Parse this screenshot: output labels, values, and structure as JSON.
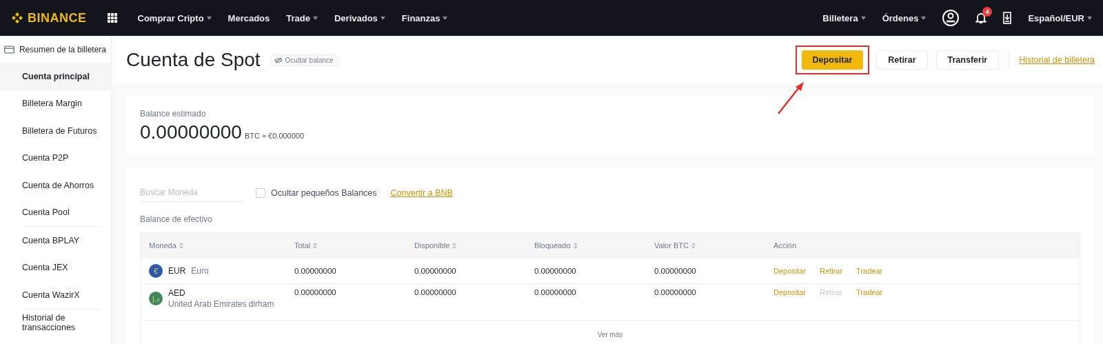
{
  "topbar": {
    "logo": "BINANCE",
    "nav": [
      {
        "label": "Comprar Cripto",
        "dropdown": true
      },
      {
        "label": "Mercados",
        "dropdown": false
      },
      {
        "label": "Trade",
        "dropdown": true
      },
      {
        "label": "Derivados",
        "dropdown": true
      },
      {
        "label": "Finanzas",
        "dropdown": true
      }
    ],
    "right": [
      {
        "label": "Billetera",
        "dropdown": true
      },
      {
        "label": "Órdenes",
        "dropdown": true
      }
    ],
    "notifications": "4",
    "language": "Español/EUR"
  },
  "sidebar": {
    "header": "Resumen de la billetera",
    "items": [
      {
        "label": "Cuenta principal",
        "selected": true,
        "divider_after": false
      },
      {
        "label": "Billetera Margin",
        "selected": false,
        "divider_after": false
      },
      {
        "label": "Billetera de Futuros",
        "selected": false,
        "divider_after": false
      },
      {
        "label": "Cuenta P2P",
        "selected": false,
        "divider_after": false
      },
      {
        "label": "Cuenta de Ahorros",
        "selected": false,
        "divider_after": false
      },
      {
        "label": "Cuenta Pool",
        "selected": false,
        "divider_after": true
      },
      {
        "label": "Cuenta BPLAY",
        "selected": false,
        "divider_after": false
      },
      {
        "label": "Cuenta JEX",
        "selected": false,
        "divider_after": false
      },
      {
        "label": "Cuenta WazirX",
        "selected": false,
        "divider_after": true
      },
      {
        "label": "Historial de transacciones",
        "selected": false,
        "divider_after": false
      }
    ]
  },
  "header": {
    "title": "Cuenta de Spot",
    "hide_balance": "Ocultar balance",
    "buttons": [
      {
        "label": "Depositar",
        "kind": "primary",
        "highlighted": true
      },
      {
        "label": "Retirar",
        "kind": "outline",
        "highlighted": false
      },
      {
        "label": "Transferir",
        "kind": "outline",
        "highlighted": false
      }
    ],
    "history_link": "Historial de billetera"
  },
  "balance": {
    "label": "Balance estimado",
    "amount": "0.00000000",
    "unit": "BTC ≈ €0.000000"
  },
  "filters": {
    "search": {
      "placeholder": "Buscar Moneda"
    },
    "hide_small": {
      "label": "Ocultar pequeños Balances",
      "checked": false
    },
    "convert_link": "Convertir a BNB"
  },
  "section_title": "Balance de efectivo",
  "table": {
    "columns": [
      {
        "label": "Moneda",
        "sortable": true
      },
      {
        "label": "Total",
        "sortable": true
      },
      {
        "label": "Disponible",
        "sortable": true
      },
      {
        "label": "Bloqueado",
        "sortable": true
      },
      {
        "label": "Valor BTC",
        "sortable": true
      },
      {
        "label": "Acción",
        "sortable": false
      }
    ],
    "rows": [
      {
        "coin": "EUR",
        "name": "Euro",
        "icon_symbol": "€",
        "color": "#2c5aa8",
        "kind": "inline",
        "values": [
          "0.00000000",
          "0.00000000",
          "0.00000000",
          "0.00000000"
        ],
        "actions": [
          {
            "label": "Depositar",
            "disabled": false
          },
          {
            "label": "Retirar",
            "disabled": false
          },
          {
            "label": "Tradear",
            "disabled": false
          }
        ]
      },
      {
        "coin": "AED",
        "name": "United Arab Emirates dirham",
        "icon_symbol": "د.إ",
        "color": "#3e8a5e",
        "kind": "stacked",
        "values": [
          "0.00000000",
          "0.00000000",
          "0.00000000",
          "0.00000000"
        ],
        "actions": [
          {
            "label": "Depositar",
            "disabled": false
          },
          {
            "label": "Retirar",
            "disabled": true
          },
          {
            "label": "Tradear",
            "disabled": false
          }
        ]
      }
    ],
    "more": "Ver más"
  }
}
